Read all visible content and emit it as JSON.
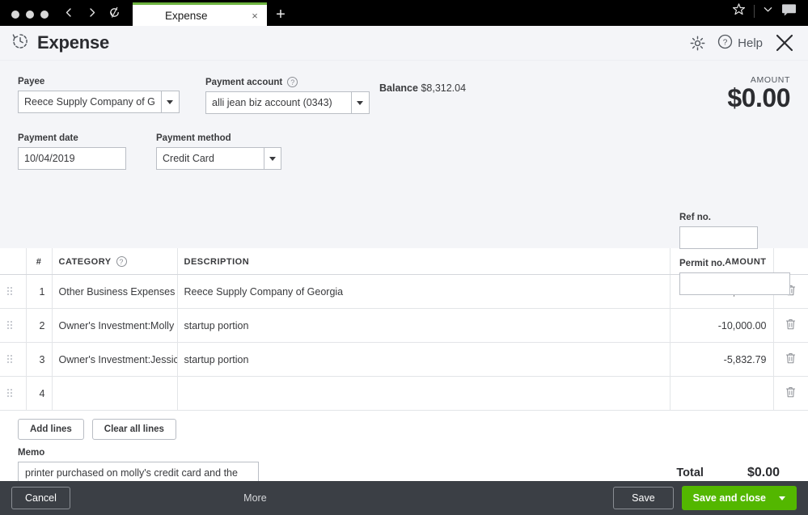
{
  "browser": {
    "tab_title": "Expense",
    "tab_close": "×",
    "new_tab": "+",
    "back_icon": "back-arrow-icon",
    "forward_icon": "forward-arrow-icon",
    "reload_icon": "reload-icon",
    "star_icon": "star-icon",
    "chevron_icon": "chevron-down-icon",
    "comment_icon": "comment-icon",
    "accent_color": "#6db33f"
  },
  "header": {
    "title": "Expense",
    "title_icon": "transaction-history-icon",
    "gear_icon": "gear-icon",
    "help_icon": "question-circle-icon",
    "help_label": "Help",
    "close_icon": "close-icon"
  },
  "form": {
    "payee": {
      "label": "Payee",
      "value": "Reece Supply Company of Georg",
      "placeholder": ""
    },
    "payment_account": {
      "label": "Payment account",
      "help_icon": "question-circle-icon",
      "value": "alli jean biz account (0343)",
      "placeholder": ""
    },
    "balance": {
      "label": "Balance",
      "value": "$8,312.04"
    },
    "amount": {
      "label": "AMOUNT",
      "value": "$0.00"
    },
    "payment_date": {
      "label": "Payment date",
      "value": "10/04/2019",
      "placeholder": ""
    },
    "payment_method": {
      "label": "Payment method",
      "value": "Credit Card",
      "placeholder": ""
    },
    "ref_no": {
      "label": "Ref no.",
      "value": "",
      "placeholder": ""
    },
    "permit_no": {
      "label": "Permit no.",
      "value": "",
      "placeholder": ""
    }
  },
  "lines": {
    "columns": {
      "num": "#",
      "category": "CATEGORY",
      "category_help_icon": "question-circle-icon",
      "description": "DESCRIPTION",
      "amount": "AMOUNT"
    },
    "rows": [
      {
        "num": "1",
        "category": "Other Business Expenses",
        "description": "Reece Supply Company of Georgia",
        "amount": "15,832.79",
        "delete_icon": "trash-icon",
        "handle_icon": "drag-handle-icon"
      },
      {
        "num": "2",
        "category": "Owner's Investment:Molly Own",
        "description": "startup portion",
        "amount": "-10,000.00",
        "delete_icon": "trash-icon",
        "handle_icon": "drag-handle-icon"
      },
      {
        "num": "3",
        "category": "Owner's Investment:Jessica Ow",
        "description": "startup portion",
        "amount": "-5,832.79",
        "delete_icon": "trash-icon",
        "handle_icon": "drag-handle-icon"
      },
      {
        "num": "4",
        "category": "",
        "description": "",
        "amount": "",
        "delete_icon": "trash-icon",
        "handle_icon": "drag-handle-icon"
      }
    ],
    "add_lines_label": "Add lines",
    "clear_all_lines_label": "Clear all lines"
  },
  "memo": {
    "label": "Memo",
    "value": "printer purchased on molly's credit card and the portion I paid her from my personal check",
    "placeholder": ""
  },
  "total": {
    "label": "Total",
    "value": "$0.00"
  },
  "footer": {
    "cancel_label": "Cancel",
    "more_label": "More",
    "save_label": "Save",
    "save_and_close_label": "Save and close",
    "save_and_close_caret": "chevron-down-icon",
    "primary_color": "#53b700"
  }
}
